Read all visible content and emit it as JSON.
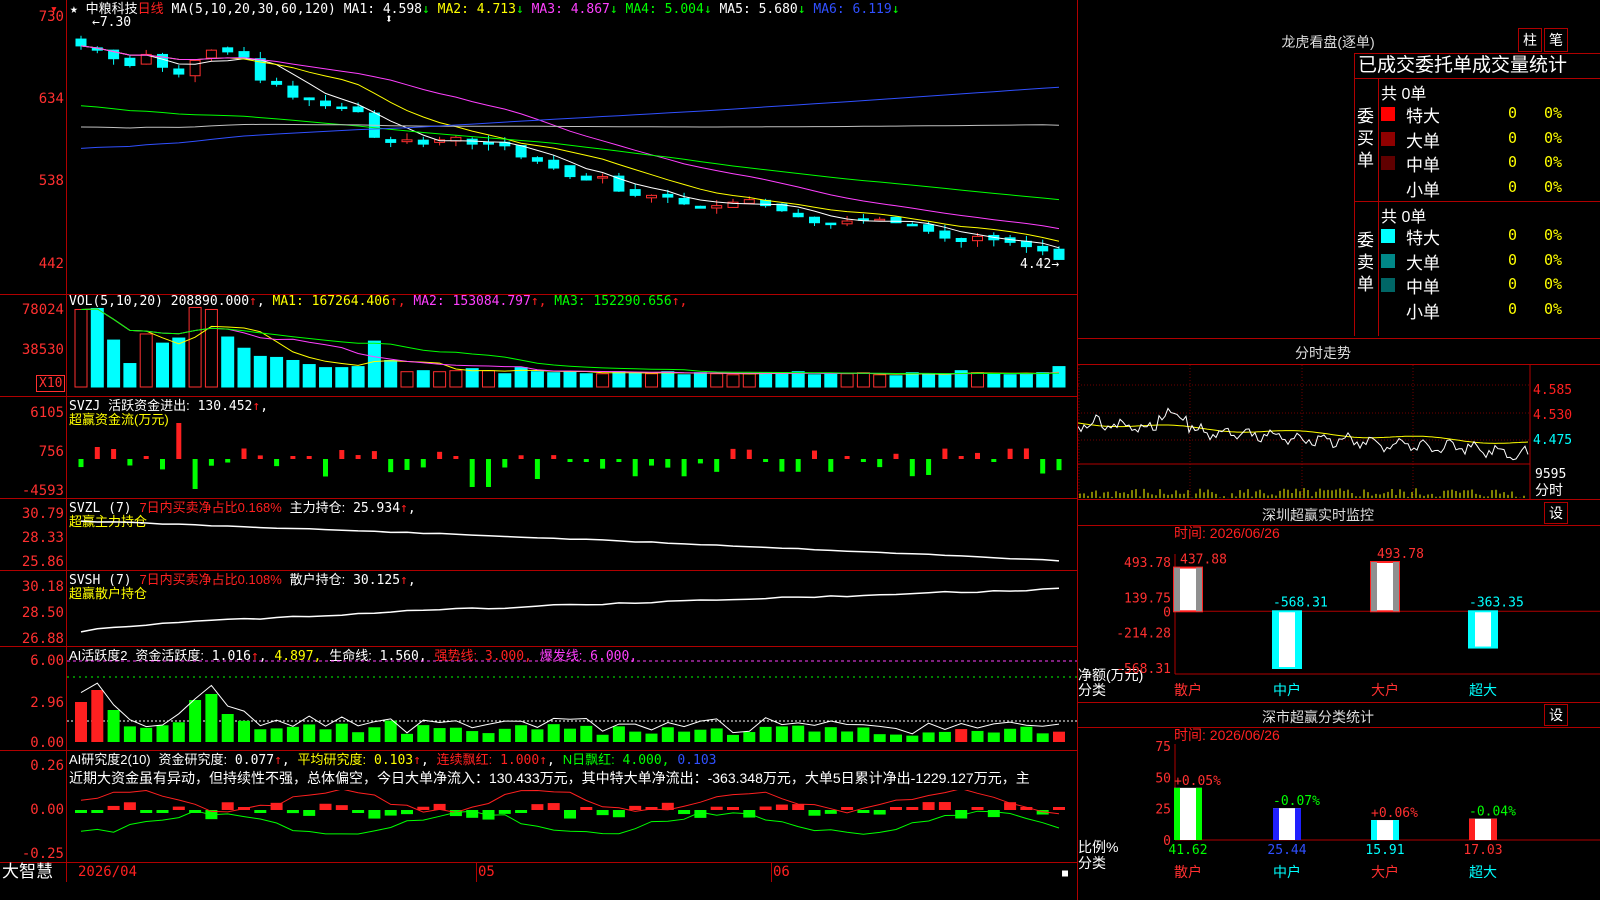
{
  "app_name": "大智慧",
  "stock": {
    "star": "★",
    "name": "中粮科技",
    "period": "日线"
  },
  "main_panel": {
    "ma_label": "MA(5,10,20,30,60,120)",
    "ma": [
      {
        "label": "MA1:",
        "value": "4.598",
        "arrow": "↓",
        "color": "#ffffff"
      },
      {
        "label": "MA2:",
        "value": "4.713",
        "arrow": "↓",
        "color": "#ffff00"
      },
      {
        "label": "MA3:",
        "value": "4.867",
        "arrow": "↓",
        "color": "#ff40ff"
      },
      {
        "label": "MA4:",
        "value": "5.004",
        "arrow": "↓",
        "color": "#00ff00"
      },
      {
        "label": "MA5:",
        "value": "5.680",
        "arrow": "↓",
        "color": "#ffffff"
      },
      {
        "label": "MA6:",
        "value": "6.119",
        "arrow": "↓",
        "color": "#3050ff"
      }
    ],
    "y_labels": [
      "730",
      "634",
      "538",
      "442"
    ],
    "high_label": "7.30",
    "low_label": "4.42",
    "closes": [
      6.95,
      6.9,
      6.8,
      6.72,
      6.85,
      6.7,
      6.62,
      6.78,
      6.9,
      6.88,
      6.82,
      6.55,
      6.5,
      6.35,
      6.32,
      6.25,
      6.22,
      6.18,
      5.88,
      5.82,
      5.85,
      5.8,
      5.85,
      5.88,
      5.8,
      5.8,
      5.78,
      5.65,
      5.6,
      5.52,
      5.42,
      5.38,
      5.42,
      5.25,
      5.2,
      5.2,
      5.18,
      5.1,
      5.05,
      5.08,
      5.12,
      5.15,
      5.08,
      5.02,
      4.95,
      4.88,
      4.87,
      4.9,
      4.92,
      4.92,
      4.88,
      4.85,
      4.78,
      4.7,
      4.66,
      4.72,
      4.68,
      4.65,
      4.6,
      4.55,
      4.45
    ]
  },
  "vol_panel": {
    "label": "VOL(5,10,20)",
    "value": "208890.000",
    "ma": [
      {
        "label": "MA1:",
        "value": "167264.406",
        "arrow": "↑",
        "color": "#ffff00"
      },
      {
        "label": "MA2:",
        "value": "153084.797",
        "arrow": "↑",
        "color": "#ff40ff"
      },
      {
        "label": "MA3:",
        "value": "152290.656",
        "arrow": "↑",
        "color": "#00ff00"
      }
    ],
    "y_labels": [
      "78024",
      "38530"
    ],
    "unit": "X10",
    "values": [
      7.6,
      7.7,
      4.6,
      2.3,
      5.2,
      4.3,
      4.8,
      7.8,
      7.6,
      4.9,
      3.8,
      3.0,
      2.9,
      2.6,
      2.2,
      1.9,
      1.9,
      2.0,
      4.5,
      2.6,
      1.5,
      1.6,
      1.5,
      1.6,
      1.8,
      1.6,
      1.3,
      1.9,
      1.5,
      1.4,
      1.5,
      1.3,
      1.3,
      1.5,
      1.4,
      1.3,
      1.5,
      1.2,
      1.4,
      1.3,
      1.2,
      1.3,
      1.4,
      1.4,
      1.5,
      1.2,
      1.3,
      1.3,
      1.4,
      1.2,
      1.1,
      1.4,
      1.3,
      1.2,
      1.6,
      1.4,
      1.3,
      1.2,
      1.3,
      1.4,
      2.0
    ]
  },
  "svzj_panel": {
    "label": "SVZJ",
    "desc": "活跃资金进出:",
    "value": "130.452",
    "arrow": "↑",
    "subtitle": "超赢资金流(万元)",
    "y_labels": [
      "6105",
      "756",
      "-4593"
    ]
  },
  "svzl_panel": {
    "label": "SVZL (7)",
    "red_text": "7日内买卖净占比0.168%",
    "desc": "主力持仓:",
    "value": "25.934",
    "arrow": "↑",
    "subtitle": "超赢主力持仓",
    "y_labels": [
      "30.79",
      "28.33",
      "25.86"
    ]
  },
  "svsh_panel": {
    "label": "SVSH (7)",
    "red_text": "7日内买卖净占比0.108%",
    "desc": "散户持仓:",
    "value": "30.125",
    "arrow": "↑",
    "subtitle": "超赢散户持仓",
    "y_labels": [
      "30.18",
      "28.50",
      "26.88"
    ]
  },
  "ai_active_panel": {
    "label": "AI活跃度2",
    "desc": "资金活跃度:",
    "value": "1.016",
    "value2": "4.897,",
    "life_label": "生命线:",
    "life_value": "1.560,",
    "strong_label": "强势线:",
    "strong_value": "3.000,",
    "burst_label": "爆发线:",
    "burst_value": "6.000,",
    "y_labels": [
      "6.00",
      "2.96",
      "0.00"
    ]
  },
  "ai_research_panel": {
    "label": "AI研究度2(10)",
    "desc": "资金研究度:",
    "value": "0.077",
    "avg_label": "平均研究度:",
    "avg_value": "0.103",
    "red_label": "连续飘红:",
    "red_value": "1.000",
    "n_label": "N日飘红:",
    "n_value": "4.000,",
    "n_value2": "0.103",
    "comment": "近期大资金虽有异动，但持续性不强，总体偏空，今日大单净流入：130.433万元，其中特大单净流出：-363.348万元，大单5日累计净出-1229.127万元，主",
    "y_labels": [
      "0.26",
      "0.00",
      "-0.25"
    ]
  },
  "x_axis": {
    "labels": [
      "2026/04",
      "05",
      "06"
    ]
  },
  "dragon_tiger": {
    "title": "龙虎看盘(逐单)",
    "btn_bar": "柱",
    "btn_stroke": "笔",
    "stats_title": "已成交委托单成交量统计",
    "buy": {
      "side_label": "委买单",
      "total": "共 0单",
      "rows": [
        {
          "label": "特大",
          "count": "0",
          "pct": "0%",
          "color": "#ff0000"
        },
        {
          "label": "大单",
          "count": "0",
          "pct": "0%",
          "color": "#900000"
        },
        {
          "label": "中单",
          "count": "0",
          "pct": "0%",
          "color": "#600000"
        },
        {
          "label": "小单",
          "count": "0",
          "pct": "0%",
          "color": "#000000"
        }
      ]
    },
    "sell": {
      "side_label": "委卖单",
      "total": "共 0单",
      "rows": [
        {
          "label": "特大",
          "count": "0",
          "pct": "0%",
          "color": "#00ffff"
        },
        {
          "label": "大单",
          "count": "0",
          "pct": "0%",
          "color": "#008888"
        },
        {
          "label": "中单",
          "count": "0",
          "pct": "0%",
          "color": "#006666"
        },
        {
          "label": "小单",
          "count": "0",
          "pct": "0%",
          "color": "#000000"
        }
      ]
    }
  },
  "intraday": {
    "title": "分时走势",
    "y_labels": [
      "4.585",
      "4.530",
      "4.475"
    ],
    "vol_label": "9595",
    "label": "分时"
  },
  "monitor": {
    "title": "深圳超赢实时监控",
    "btn": "设",
    "date": "时间: 2026/06/26",
    "y_labels": [
      "493.78",
      "139.75",
      "0",
      "-214.28",
      "-568.31"
    ],
    "axis_title": "净额(万元)",
    "axis_sub": "分类",
    "chart_data": {
      "type": "bar",
      "categories": [
        "散户",
        "中户",
        "大户",
        "超大"
      ],
      "values": [
        437.88,
        -568.31,
        493.78,
        -363.35
      ],
      "labels": [
        "437.88",
        "-568.31",
        "493.78",
        "-363.35"
      ],
      "ylabel": "净额(万元)",
      "ylim": [
        -568.31,
        493.78
      ]
    }
  },
  "classify": {
    "title": "深市超赢分类统计",
    "btn": "设",
    "date": "时间: 2026/06/26",
    "y_labels": [
      "75",
      "50",
      "25",
      "0"
    ],
    "axis_title": "比例%",
    "axis_sub": "分类",
    "chart_data": {
      "type": "bar",
      "categories": [
        "散户",
        "中户",
        "大户",
        "超大"
      ],
      "values": [
        41.62,
        25.44,
        15.91,
        17.03
      ],
      "changes": [
        "+0.05%",
        "-0.07%",
        "+0.06%",
        "-0.04%"
      ],
      "ylabel": "比例%",
      "ylim": [
        0,
        75
      ]
    }
  }
}
